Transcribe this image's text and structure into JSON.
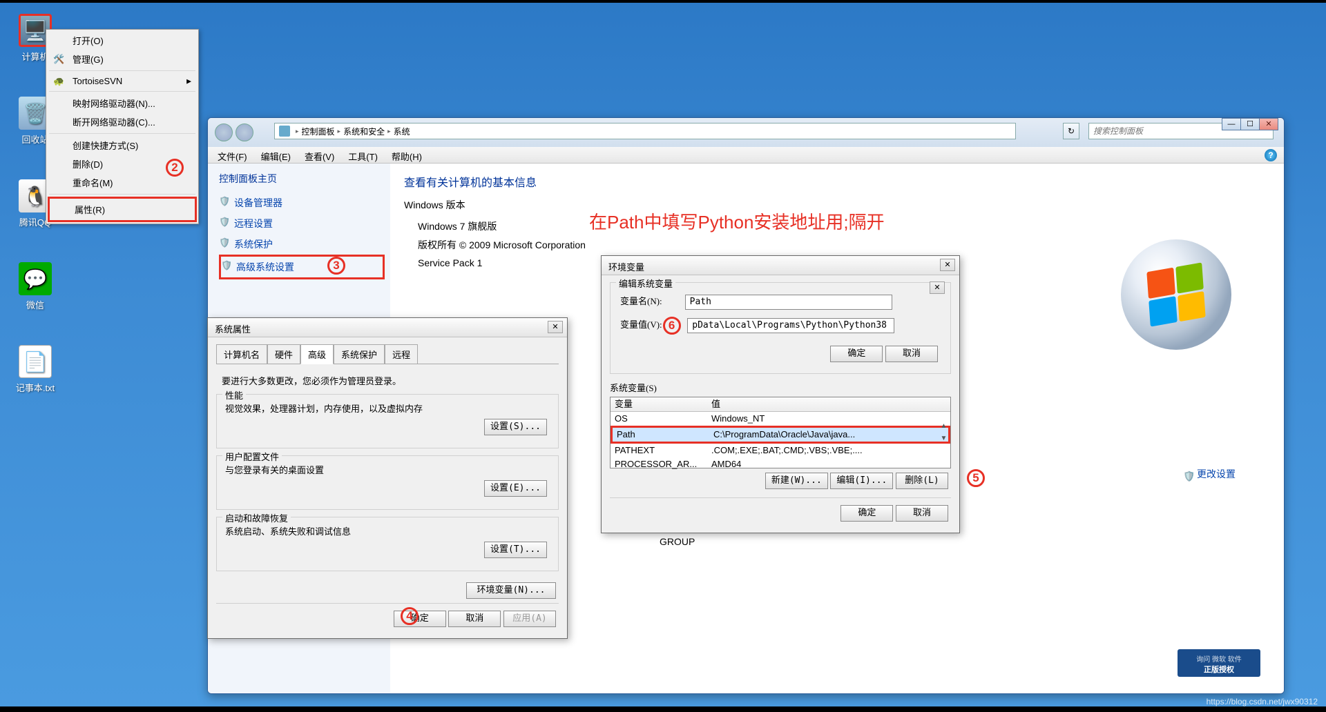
{
  "desktop": {
    "icons": {
      "computer": "计算机",
      "recycle": "回收站",
      "qq": "腾讯QQ",
      "wechat": "微信",
      "notepad": "记事本.txt"
    }
  },
  "contextMenu": {
    "open": "打开(O)",
    "manage": "管理(G)",
    "tortoise": "TortoiseSVN",
    "mapnet": "映射网络驱动器(N)...",
    "disconnect": "断开网络驱动器(C)...",
    "shortcut": "创建快捷方式(S)",
    "delete": "删除(D)",
    "rename": "重命名(M)",
    "properties": "属性(R)"
  },
  "explorer": {
    "breadcrumb": {
      "p1": "控制面板",
      "p2": "系统和安全",
      "p3": "系统"
    },
    "searchPlaceholder": "搜索控制面板",
    "menu": {
      "file": "文件(F)",
      "edit": "编辑(E)",
      "view": "查看(V)",
      "tools": "工具(T)",
      "help": "帮助(H)"
    },
    "side": {
      "title": "控制面板主页",
      "devmgr": "设备管理器",
      "remote": "远程设置",
      "sysprotect": "系统保护",
      "advanced": "高级系统设置"
    },
    "main": {
      "heading": "查看有关计算机的基本信息",
      "winver": "Windows 版本",
      "edition": "Windows 7 旗舰版",
      "copyright": "版权所有 © 2009 Microsoft Corporation",
      "sp": "Service Pack 1",
      "group": "GROUP",
      "changesettings": "更改设置"
    }
  },
  "redNote": "在Path中填写Python安装地址用;隔开",
  "syspropDlg": {
    "title": "系统属性",
    "tabs": {
      "computer": "计算机名",
      "hardware": "硬件",
      "advanced": "高级",
      "sysprotect": "系统保护",
      "remote": "远程"
    },
    "note": "要进行大多数更改，您必须作为管理员登录。",
    "perf": {
      "label": "性能",
      "desc": "视觉效果，处理器计划，内存使用，以及虚拟内存",
      "btn": "设置(S)..."
    },
    "profile": {
      "label": "用户配置文件",
      "desc": "与您登录有关的桌面设置",
      "btn": "设置(E)..."
    },
    "startup": {
      "label": "启动和故障恢复",
      "desc": "系统启动、系统失败和调试信息",
      "btn": "设置(T)..."
    },
    "envbtn": "环境变量(N)...",
    "ok": "确定",
    "cancel": "取消",
    "apply": "应用(A)"
  },
  "envDlg": {
    "title": "环境变量",
    "editTitle": "编辑系统变量",
    "varname_lbl": "变量名(N):",
    "varname_val": "Path",
    "varval_lbl": "变量值(V):",
    "varval_val": "pData\\Local\\Programs\\Python\\Python38",
    "ok": "确定",
    "cancel": "取消",
    "sysvars_lbl": "系统变量(S)",
    "cols": {
      "var": "变量",
      "val": "值"
    },
    "rows": [
      {
        "k": "OS",
        "v": "Windows_NT"
      },
      {
        "k": "Path",
        "v": "C:\\ProgramData\\Oracle\\Java\\java..."
      },
      {
        "k": "PATHEXT",
        "v": ".COM;.EXE;.BAT;.CMD;.VBS;.VBE;...."
      },
      {
        "k": "PROCESSOR_AR...",
        "v": "AMD64"
      }
    ],
    "new": "新建(W)...",
    "edit": "编辑(I)...",
    "del": "删除(L)"
  },
  "badges": {
    "n2": "2",
    "n3": "3",
    "n4": "4",
    "n5": "5",
    "n6": "6"
  },
  "genuine": "正版授权",
  "watermark": "https://blog.csdn.net/jwx90312"
}
